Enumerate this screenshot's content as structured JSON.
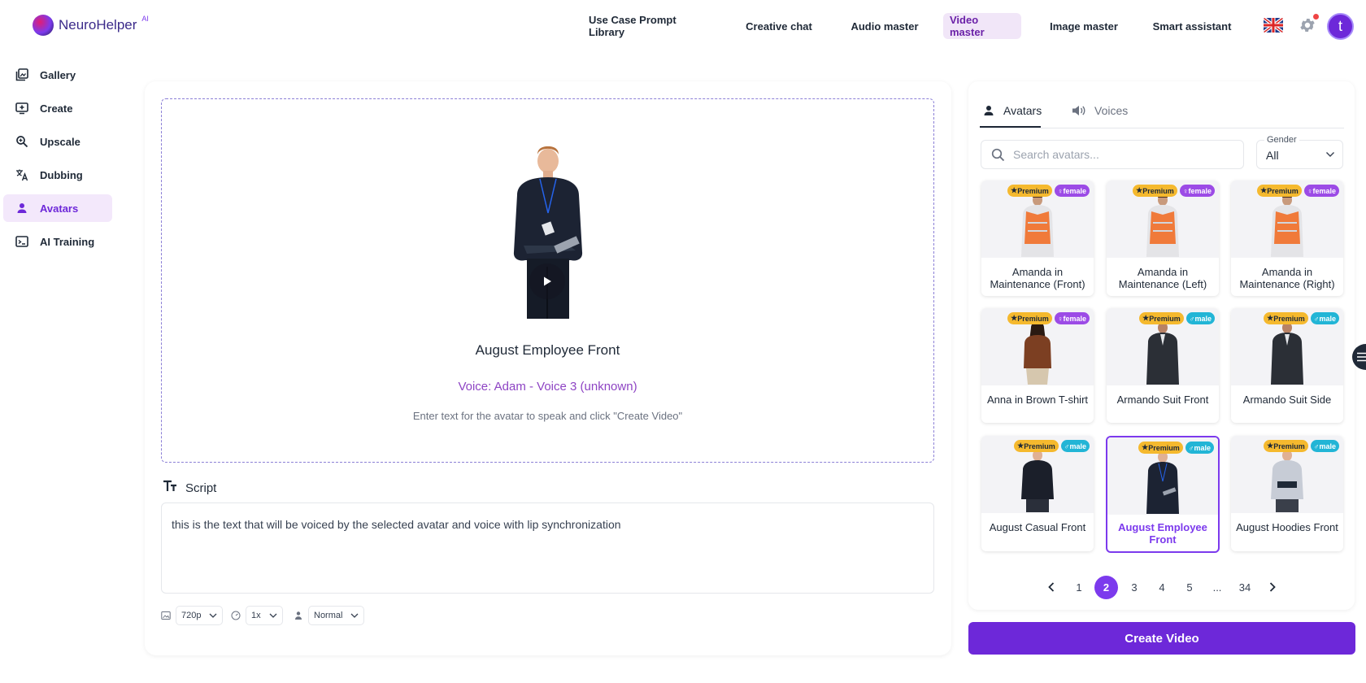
{
  "brand": {
    "name_a": "Neuro",
    "name_b": "Helper",
    "superscript": "AI"
  },
  "nav": [
    {
      "label": "Use Case Prompt Library",
      "active": false
    },
    {
      "label": "Creative chat",
      "active": false
    },
    {
      "label": "Audio master",
      "active": false
    },
    {
      "label": "Video master",
      "active": true
    },
    {
      "label": "Image master",
      "active": false
    },
    {
      "label": "Smart assistant",
      "active": false
    }
  ],
  "user": {
    "initial": "t"
  },
  "sidebar": [
    {
      "label": "Gallery",
      "icon": "gallery-icon",
      "active": false
    },
    {
      "label": "Create",
      "icon": "create-icon",
      "active": false
    },
    {
      "label": "Upscale",
      "icon": "upscale-icon",
      "active": false
    },
    {
      "label": "Dubbing",
      "icon": "translate-icon",
      "active": false
    },
    {
      "label": "Avatars",
      "icon": "person-icon",
      "active": true
    },
    {
      "label": "AI Training",
      "icon": "terminal-icon",
      "active": false
    }
  ],
  "preview": {
    "title": "August Employee Front",
    "voice": "Voice: Adam - Voice 3 (unknown)",
    "hint": "Enter text for the avatar to speak and click \"Create Video\""
  },
  "script": {
    "label": "Script",
    "text": "this is the text that will be voiced by the selected avatar and voice with lip synchronization"
  },
  "options": {
    "resolution": "720p",
    "speed": "1x",
    "mode": "Normal"
  },
  "tabs": {
    "avatars": "Avatars",
    "voices": "Voices"
  },
  "search": {
    "placeholder": "Search avatars..."
  },
  "gender": {
    "label": "Gender",
    "value": "All"
  },
  "badges": {
    "premium": "Premium"
  },
  "avatars": [
    {
      "name": "Amanda in Maintenance (Front)",
      "gender": "female",
      "selected": false
    },
    {
      "name": "Amanda in Maintenance (Left)",
      "gender": "female",
      "selected": false
    },
    {
      "name": "Amanda in Maintenance (Right)",
      "gender": "female",
      "selected": false
    },
    {
      "name": "Anna in Brown T-shirt",
      "gender": "female",
      "selected": false
    },
    {
      "name": "Armando Suit Front",
      "gender": "male",
      "selected": false
    },
    {
      "name": "Armando Suit Side",
      "gender": "male",
      "selected": false
    },
    {
      "name": "August Casual Front",
      "gender": "male",
      "selected": false
    },
    {
      "name": "August Employee Front",
      "gender": "male",
      "selected": true
    },
    {
      "name": "August Hoodies Front",
      "gender": "male",
      "selected": false
    }
  ],
  "pagination": {
    "pages": [
      "1",
      "2",
      "3",
      "4",
      "5",
      "...",
      "34"
    ],
    "current": "2"
  },
  "create_button": "Create Video",
  "colors": {
    "accent": "#6d28d9",
    "premium": "#f5b92e",
    "female": "#9c4be6",
    "male": "#22b5d6"
  }
}
